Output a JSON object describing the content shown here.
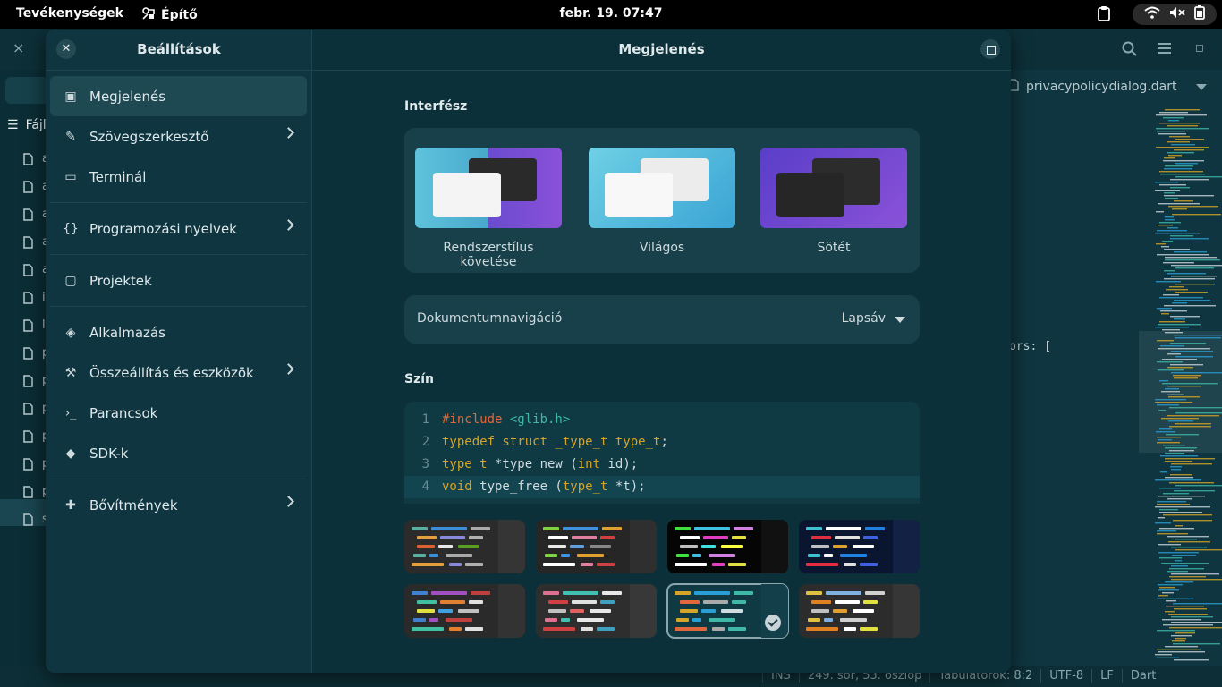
{
  "topbar": {
    "activities": "Tevékenységek",
    "app_name": "Építő",
    "clock": "febr. 19.  07:47"
  },
  "background_editor": {
    "sidebar_label": "Fájl",
    "file_initials": [
      "a",
      "a",
      "a",
      "a",
      "a",
      "i",
      "l",
      "p",
      "p",
      "p",
      "p",
      "p",
      "p",
      "s"
    ],
    "tab_label": "privacypolicydialog.dart",
    "code_snippet": "ors: [",
    "status": {
      "mode": "INS",
      "position": "249. sor, 53. oszlop",
      "tabs": "Tabulátorok: 8:2",
      "encoding": "UTF-8",
      "line_ending": "LF",
      "language": "Dart"
    }
  },
  "dialog": {
    "sidebar_title": "Beállítások",
    "main_title": "Megjelenés",
    "nav_groups": [
      [
        {
          "label": "Megjelenés",
          "icon": "appearance-icon",
          "active": true,
          "chevron": false
        },
        {
          "label": "Szövegszerkesztő",
          "icon": "pencil-icon",
          "active": false,
          "chevron": true
        },
        {
          "label": "Terminál",
          "icon": "terminal-icon",
          "active": false,
          "chevron": false
        }
      ],
      [
        {
          "label": "Programozási nyelvek",
          "icon": "code-braces-icon",
          "active": false,
          "chevron": true
        }
      ],
      [
        {
          "label": "Projektek",
          "icon": "folder-icon",
          "active": false,
          "chevron": false
        }
      ],
      [
        {
          "label": "Alkalmazás",
          "icon": "application-icon",
          "active": false,
          "chevron": false
        },
        {
          "label": "Összeállítás és eszközök",
          "icon": "hammer-icon",
          "active": false,
          "chevron": true
        },
        {
          "label": "Parancsok",
          "icon": "command-prompt-icon",
          "active": false,
          "chevron": false
        },
        {
          "label": "SDK-k",
          "icon": "sdk-icon",
          "active": false,
          "chevron": false
        }
      ],
      [
        {
          "label": "Bővítmények",
          "icon": "puzzle-icon",
          "active": false,
          "chevron": true
        }
      ]
    ],
    "interface": {
      "label": "Interfész",
      "styles": [
        {
          "label": "Rendszerstílus követése",
          "selected": true
        },
        {
          "label": "Világos",
          "selected": false
        },
        {
          "label": "Sötét",
          "selected": false
        }
      ]
    },
    "doc_nav": {
      "label": "Dokumentumnavigáció",
      "value": "Lapsáv"
    },
    "color": {
      "label": "Szín",
      "preview_lines": [
        {
          "n": "1",
          "parts": [
            [
              "k1",
              "#include "
            ],
            [
              "k3",
              "<glib.h>"
            ]
          ]
        },
        {
          "n": "2",
          "parts": [
            [
              "k2",
              "typedef struct _type_t type_t"
            ],
            [
              "k0",
              ";"
            ]
          ]
        },
        {
          "n": "3",
          "parts": [
            [
              "k2",
              "type_t"
            ],
            [
              "k0",
              " *type_new ("
            ],
            [
              "k2",
              "int"
            ],
            [
              "k0",
              " id);"
            ]
          ]
        },
        {
          "n": "4",
          "parts": [
            [
              "k2",
              "void"
            ],
            [
              "k0",
              " type_free ("
            ],
            [
              "k2",
              "type_t"
            ],
            [
              "k0",
              " *t);"
            ]
          ]
        }
      ],
      "current_line": 4,
      "selected_scheme": 6,
      "scheme_colors": [
        {
          "bg": "#2b2b2b",
          "strip": "#353535",
          "bars": [
            "#5ab0a0",
            "#3a8fd8",
            "#aaaaaa",
            "#e0a040",
            "#8888dd",
            "#b0b0b0",
            "#e06030",
            "#e8e8e8",
            "#5aa020"
          ]
        },
        {
          "bg": "#262626",
          "strip": "#2f2f2f",
          "bars": [
            "#80d040",
            "#4090e0",
            "#e0a030",
            "#ffffff",
            "#e080a0",
            "#d04040",
            "#e8e8e8",
            "#60a0e0",
            "#888888"
          ]
        },
        {
          "bg": "#050505",
          "strip": "#111111",
          "bars": [
            "#40e040",
            "#40c0e0",
            "#d080e0",
            "#ffffff",
            "#e040c0",
            "#e0e040",
            "#c0c0c0",
            "#40e0e0",
            "#ffff40"
          ]
        },
        {
          "bg": "#0a1630",
          "strip": "#132244",
          "bars": [
            "#40c0d0",
            "#ffffff",
            "#2080e0",
            "#e03040",
            "#e0e0e0",
            "#4060e0",
            "#c0c0c0",
            "#e0a030",
            "#ffffff"
          ]
        },
        {
          "bg": "#2a2a2a",
          "strip": "#333333",
          "bars": [
            "#4080d0",
            "#a050c0",
            "#c04040",
            "#40c0a0",
            "#e08030",
            "#e0e0e0",
            "#e0e040",
            "#40a0e0",
            "#c0c0c0"
          ]
        },
        {
          "bg": "#2e2e2e",
          "strip": "#383838",
          "bars": [
            "#e07090",
            "#40c0b0",
            "#e8e8e8",
            "#d04040",
            "#e0e0e0",
            "#40a0c0",
            "#c0c0c0",
            "#e06060",
            "#e8e8e8"
          ]
        },
        {
          "bg": "#0f3a44",
          "strip": "#123f4a",
          "bars": [
            "#d6a428",
            "#2a9fd6",
            "#3fb8a8",
            "#e0683a",
            "#aaaaaa",
            "#3fb8a8",
            "#d6a428",
            "#2a9fd6",
            "#d0dcdf"
          ]
        },
        {
          "bg": "#2c2c2c",
          "strip": "#363636",
          "bars": [
            "#e0c040",
            "#80b0e0",
            "#d0d0d0",
            "#e08020",
            "#ffffff",
            "#e0e040",
            "#c0c0c0",
            "#e0a030",
            "#ffffff"
          ]
        }
      ]
    }
  }
}
